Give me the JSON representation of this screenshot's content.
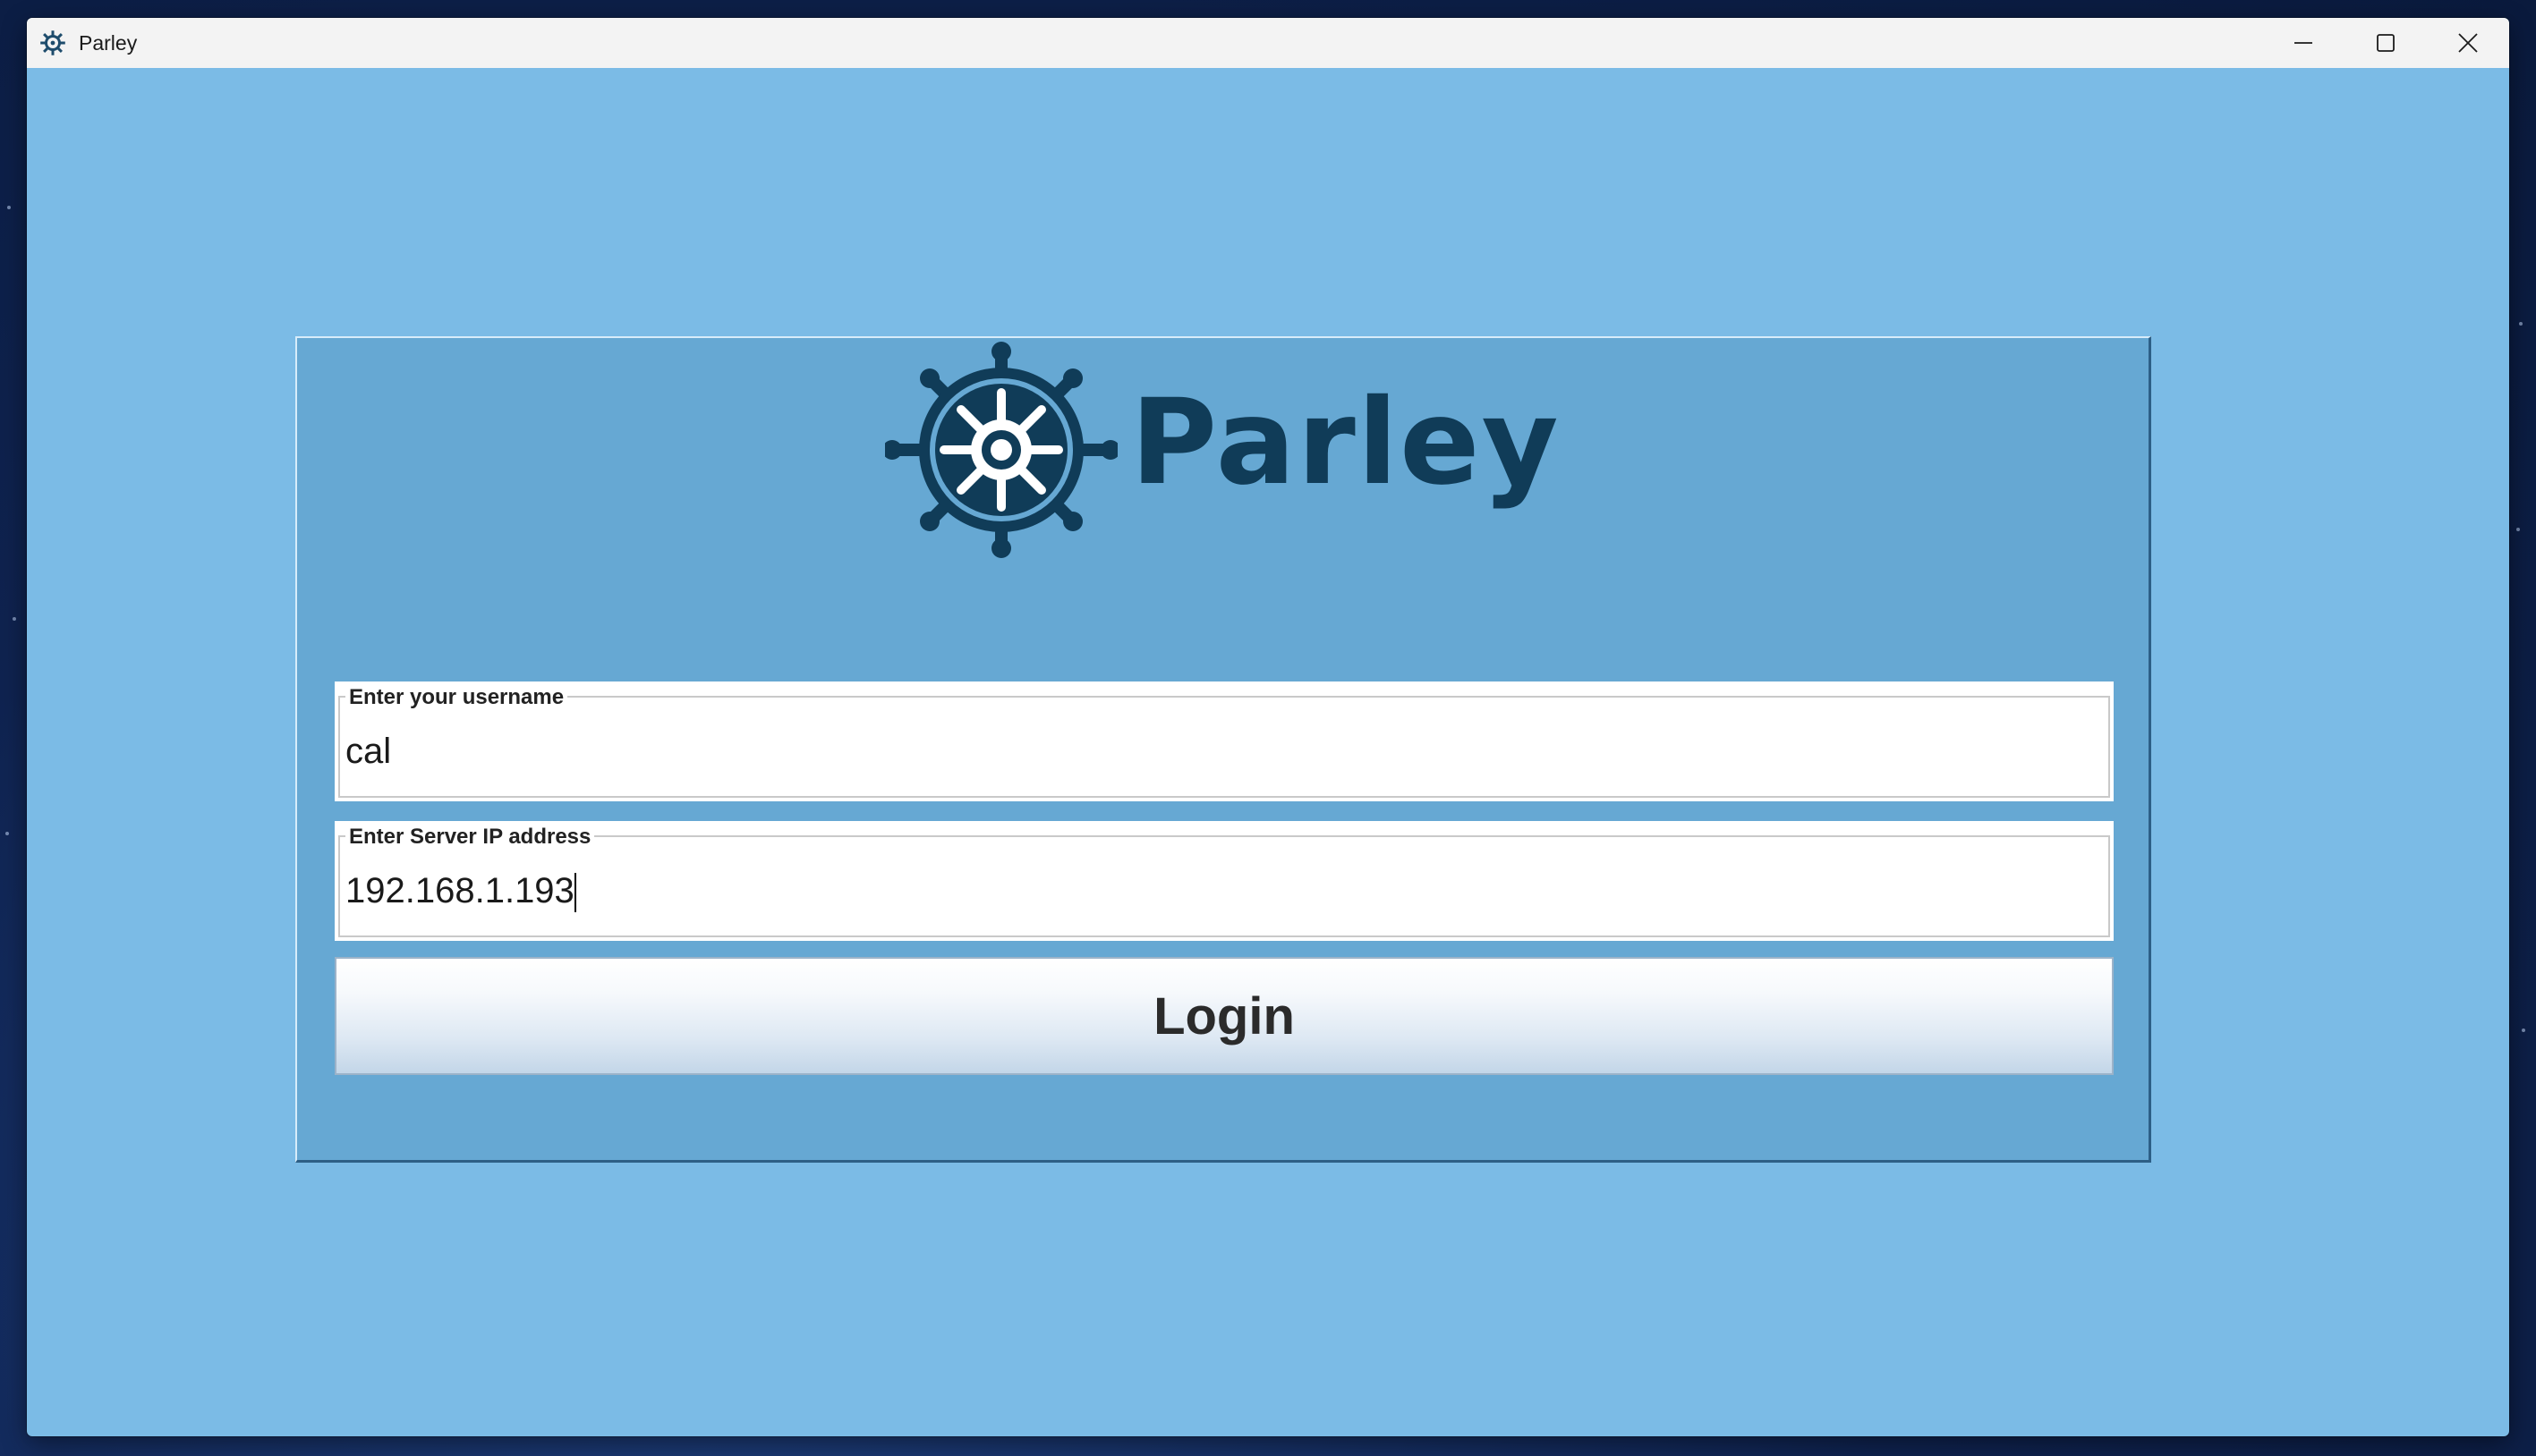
{
  "window": {
    "title": "Parley",
    "app_icon": "ship-wheel-icon",
    "controls": [
      "minimize-icon",
      "maximize-icon",
      "close-icon"
    ]
  },
  "logo": {
    "wordmark": "Parley",
    "icon": "ship-wheel-icon",
    "color": "#103c58"
  },
  "form": {
    "username": {
      "label": "Enter your username",
      "value": "cal"
    },
    "server_ip": {
      "label": "Enter Server IP address",
      "value": "192.168.1.193"
    },
    "login_label": "Login"
  },
  "colors": {
    "window_background": "#7bbbe6",
    "panel_background": "#66a8d3",
    "titlebar": "#f3f3f3"
  }
}
